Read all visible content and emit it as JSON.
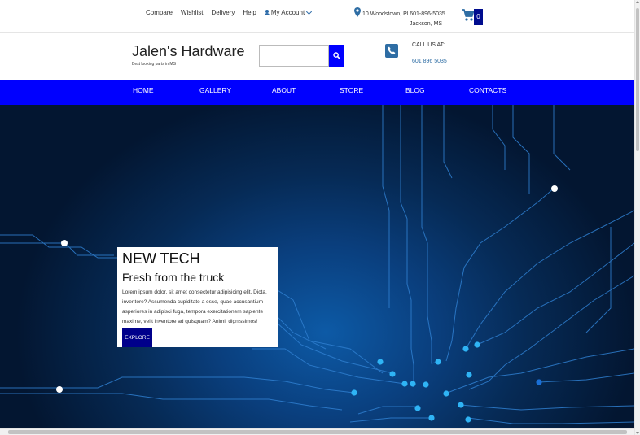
{
  "topbar": {
    "links": [
      "Compare",
      "Wishlist",
      "Delivery",
      "Help"
    ],
    "account_label": "My Account",
    "address_line1": "10 Woodstown, Pl 601-896-5035",
    "address_line2": "Jackson, MS",
    "cart_count": "0"
  },
  "header": {
    "brand_name": "Jalen's Hardware",
    "tagline": "Best looking parts in MS",
    "search_placeholder": "",
    "call_label": "CALL US AT:",
    "phone": "601 896 5035"
  },
  "nav": {
    "items": [
      "HOME",
      "GALLERY",
      "ABOUT",
      "STORE",
      "BLOG",
      "CONTACTS"
    ]
  },
  "hero": {
    "title": "NEW TECH",
    "subtitle": "Fresh from the truck",
    "body": "Lorem ipsum dolor, sit amet consectetur adipisicing elit. Dicta, inventore? Assumenda cupiditate a esse, quae accusantium asperiores in adipisci fuga, tempora exercitationem sapiente maxime, velit inventore ad quisquam? Animi, dignissimos!",
    "button_label": "EXPLORE"
  },
  "colors": {
    "nav_bg": "#0000ff",
    "button_dark": "#00008b",
    "accent": "#2e6da4"
  }
}
